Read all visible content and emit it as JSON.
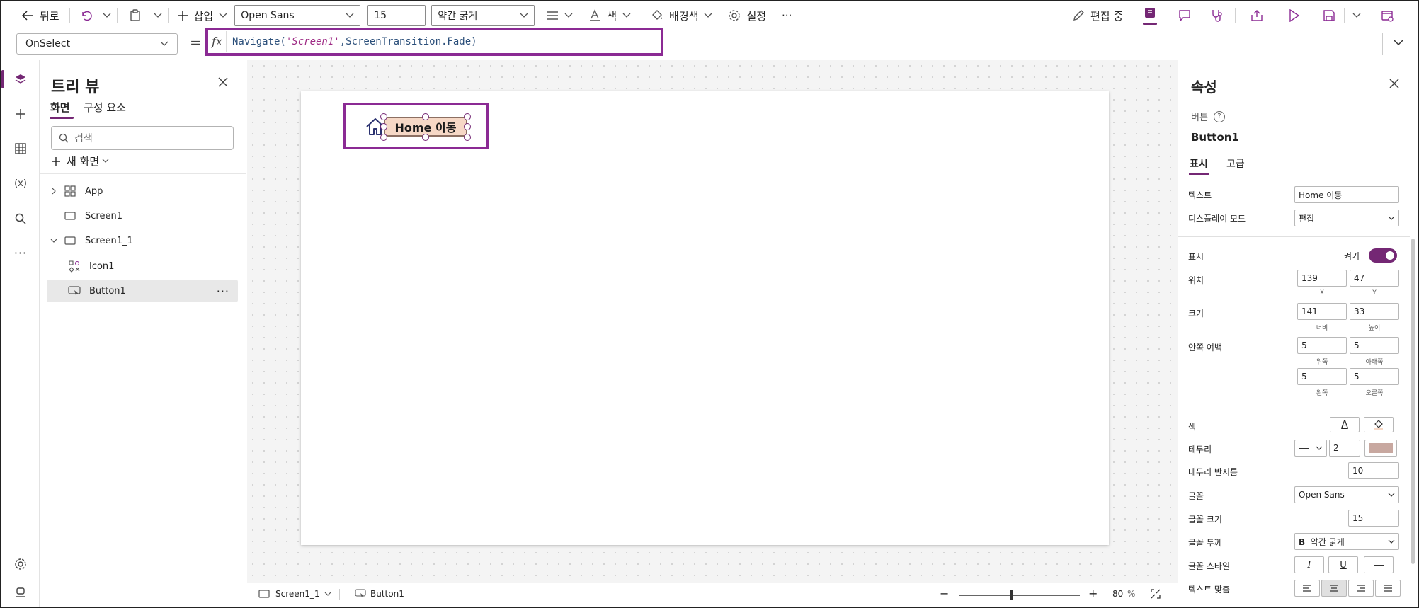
{
  "toolbar": {
    "back_label": "뒤로",
    "insert_label": "삽입",
    "font_value": "Open Sans",
    "font_size_value": "15",
    "font_weight_value": "약간 굵게",
    "color_label": "색",
    "fill_label": "배경색",
    "settings_label": "설정",
    "more_label": "···",
    "edit_mode_label": "편집 중"
  },
  "formula_bar": {
    "property": "OnSelect",
    "equals": "=",
    "fx": "fx",
    "func": "Navigate(",
    "arg1": "'Screen1'",
    "rest": ",ScreenTransition.Fade)"
  },
  "tree": {
    "title": "트리 뷰",
    "tab_screens": "화면",
    "tab_components": "구성 요소",
    "search_placeholder": "검색",
    "new_screen": "새 화면",
    "nodes": [
      "App",
      "Screen1",
      "Screen1_1",
      "Icon1",
      "Button1"
    ],
    "more": "···"
  },
  "canvas": {
    "button_text": "Home 이동"
  },
  "bottom_bar": {
    "screen": "Screen1_1",
    "control": "Button1",
    "minus": "−",
    "plus": "+",
    "zoom": "80",
    "zoom_unit": "%"
  },
  "properties": {
    "title": "속성",
    "kind": "버튼",
    "name": "Button1",
    "tab_display": "표시",
    "tab_advanced": "고급",
    "text_label": "텍스트",
    "text_value": "Home 이동",
    "display_mode_label": "디스플레이 모드",
    "display_mode_value": "편집",
    "visible_label": "표시",
    "visible_value": "켜기",
    "position_label": "위치",
    "x_value": "139",
    "y_value": "47",
    "x_caption": "X",
    "y_caption": "Y",
    "size_label": "크기",
    "width_value": "141",
    "height_value": "33",
    "width_caption": "너비",
    "height_caption": "높이",
    "padding_label": "안쪽 여백",
    "pad_top": "5",
    "pad_bottom": "5",
    "pad_left": "5",
    "pad_right": "5",
    "pad_top_caption": "위쪽",
    "pad_bottom_caption": "아래쪽",
    "pad_left_caption": "왼쪽",
    "pad_right_caption": "오른쪽",
    "color_label": "색",
    "border_label": "테두리",
    "border_width": "2",
    "border_color": "#c8a8a0",
    "radius_label": "테두리 반지름",
    "radius_value": "10",
    "font_label": "글꼴",
    "font_value": "Open Sans",
    "font_size_label": "글꼴 크기",
    "font_size_value": "15",
    "font_weight_label": "글꼴 두께",
    "font_weight_value": "약간 굵게",
    "font_style_label": "글꼴 스타일",
    "align_label": "텍스트 맞춤"
  },
  "colors": {
    "accent": "#742774",
    "highlight": "#8b2a94",
    "button_fill": "#f6d8c6"
  }
}
